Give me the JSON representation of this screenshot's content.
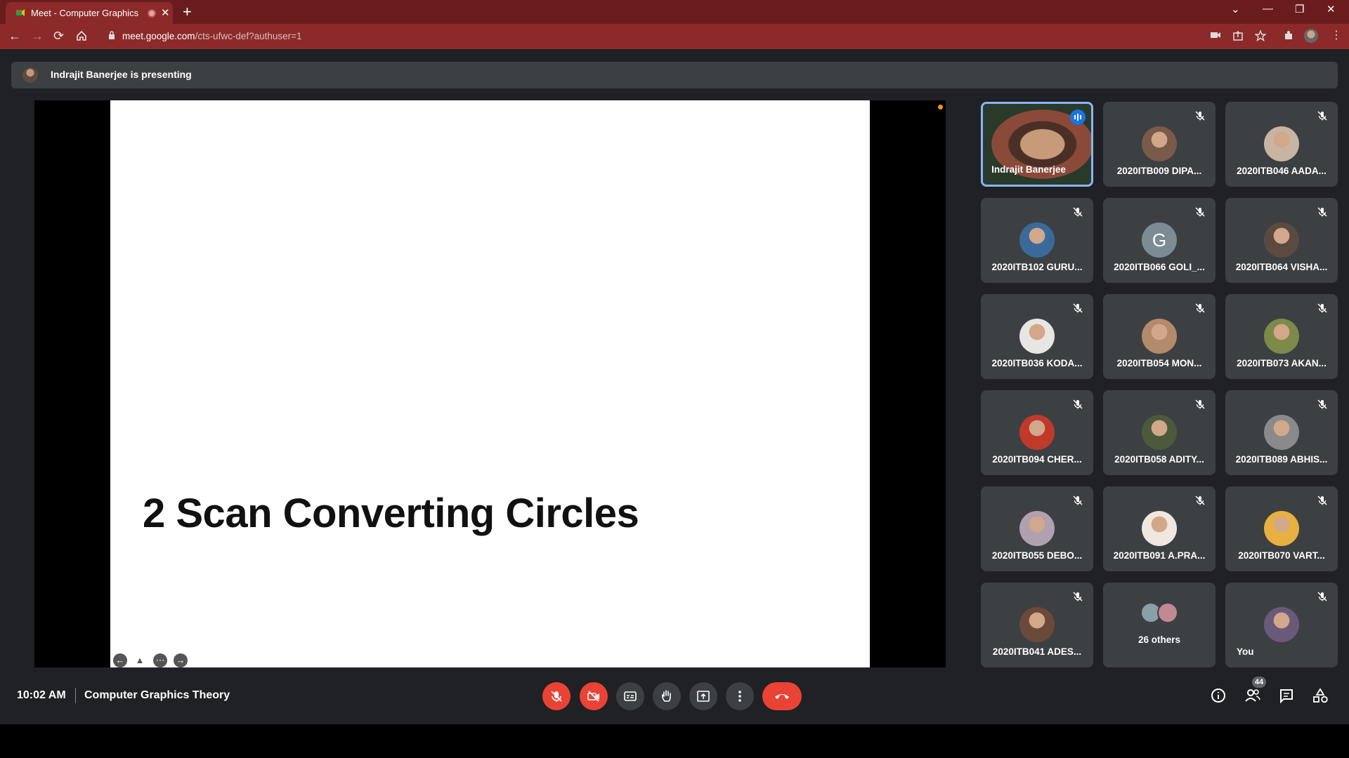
{
  "browser": {
    "tab_title": "Meet - Computer Graphics T",
    "new_tab": "+",
    "url_domain": "meet.google.com",
    "url_path": "/cts-ufwc-def?authuser=1"
  },
  "presenting_banner": "Indrajit Banerjee is presenting",
  "slide": {
    "title": "2 Scan Converting Circles"
  },
  "participants": [
    {
      "name": "Indrajit Banerjee",
      "speaking": true
    },
    {
      "name": "2020ITB009 DIPA...",
      "muted": true
    },
    {
      "name": "2020ITB046 AADA...",
      "muted": true
    },
    {
      "name": "2020ITB102 GURU...",
      "muted": true
    },
    {
      "name": "2020ITB066 GOLI_...",
      "muted": true,
      "initial": "G"
    },
    {
      "name": "2020ITB064 VISHA...",
      "muted": true
    },
    {
      "name": "2020ITB036 KODA...",
      "muted": true
    },
    {
      "name": "2020ITB054 MON...",
      "muted": true
    },
    {
      "name": "2020ITB073 AKAN...",
      "muted": true
    },
    {
      "name": "2020ITB094 CHER...",
      "muted": true
    },
    {
      "name": "2020ITB058 ADITY...",
      "muted": true
    },
    {
      "name": "2020ITB089 ABHIS...",
      "muted": true
    },
    {
      "name": "2020ITB055 DEBO...",
      "muted": true
    },
    {
      "name": "2020ITB091 A.PRA...",
      "muted": true
    },
    {
      "name": "2020ITB070 VART...",
      "muted": true
    },
    {
      "name": "2020ITB041 ADES...",
      "muted": true
    },
    {
      "name": "26 others"
    },
    {
      "name": "You",
      "muted": true
    }
  ],
  "footer": {
    "time": "10:02 AM",
    "meeting_name": "Computer Graphics Theory",
    "people_count": "44"
  },
  "colors": {
    "accent": "#8ab4f8",
    "danger": "#ea4335",
    "tile": "#3c4043",
    "bg": "#202124"
  }
}
